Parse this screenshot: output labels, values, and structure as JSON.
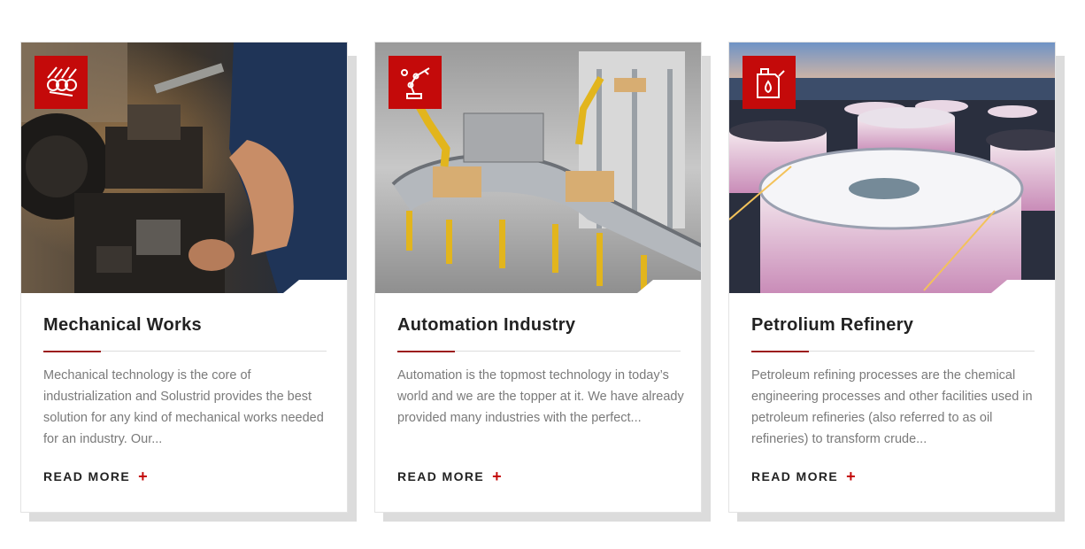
{
  "colors": {
    "accent": "#c40a0a",
    "title": "#222222",
    "body_text": "#7a7a7a"
  },
  "cards": [
    {
      "icon": "engine-icon",
      "image": "lathe-machinist-photo",
      "title": "Mechanical Works",
      "text": "Mechanical technology is the core of industrialization and Solustrid provides the best solution for any kind of mechanical works needed for an industry. Our...",
      "link_label": "READ MORE",
      "link_symbol": "+"
    },
    {
      "icon": "robot-arm-icon",
      "image": "automated-conveyor-photo",
      "title": "Automation Industry",
      "text": "Automation is the topmost technology in today’s world and we are the topper at it. We have already provided many industries with the perfect...",
      "link_label": "READ MORE",
      "link_symbol": "+"
    },
    {
      "icon": "fuel-can-icon",
      "image": "oil-storage-tanks-photo",
      "title": "Petrolium Refinery",
      "text": "Petroleum refining processes are the chemical engineering processes and other facilities used in petroleum refineries (also referred to as oil refineries) to transform crude...",
      "link_label": "READ MORE",
      "link_symbol": "+"
    }
  ]
}
